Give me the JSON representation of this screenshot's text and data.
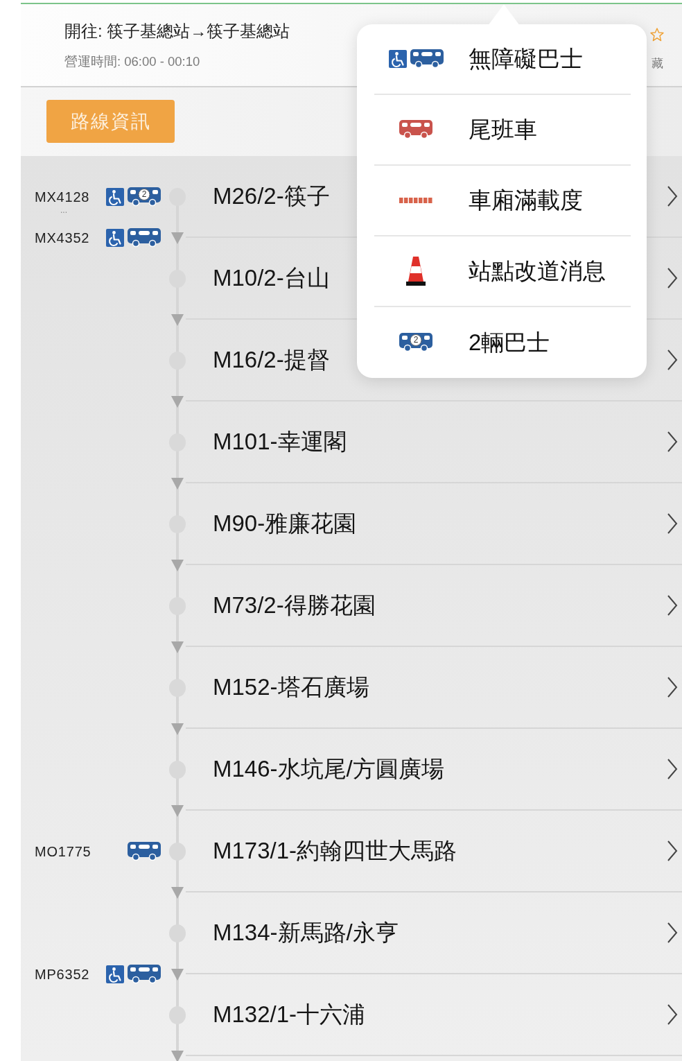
{
  "header": {
    "title": "開往: 筷子基總站→筷子基總站",
    "hours": "營運時間: 06:00 - 00:10",
    "favorite_label": "藏",
    "favorited": false
  },
  "route_info_button": "路線資訊",
  "stops": [
    {
      "name": "M26/2-筷子",
      "buses_at_stop": [
        {
          "plate": "MX4128",
          "accessible": true,
          "badge": "2"
        }
      ],
      "more": "...",
      "buses_departed": [
        {
          "plate": "MX4352",
          "accessible": true
        }
      ]
    },
    {
      "name": "M10/2-台山"
    },
    {
      "name": "M16/2-提督"
    },
    {
      "name": "M101-幸運閣"
    },
    {
      "name": "M90-雅廉花園"
    },
    {
      "name": "M73/2-得勝花園"
    },
    {
      "name": "M152-塔石廣場"
    },
    {
      "name": "M146-水坑尾/方圓廣場"
    },
    {
      "name": "M173/1-約翰四世大馬路",
      "buses_at_stop": [
        {
          "plate": "MO1775",
          "accessible": false
        }
      ]
    },
    {
      "name": "M134-新馬路/永亨",
      "buses_departed": [
        {
          "plate": "MP6352",
          "accessible": true
        }
      ]
    },
    {
      "name": "M132/1-十六浦"
    }
  ],
  "legend": [
    {
      "kind": "accessible_bus",
      "label": "無障礙巴士"
    },
    {
      "kind": "last_bus",
      "label": "尾班車"
    },
    {
      "kind": "load",
      "label": "車廂滿載度"
    },
    {
      "kind": "diversion",
      "label": "站點改道消息"
    },
    {
      "kind": "multi_bus",
      "label": "2輛巴士",
      "badge": "2"
    }
  ]
}
